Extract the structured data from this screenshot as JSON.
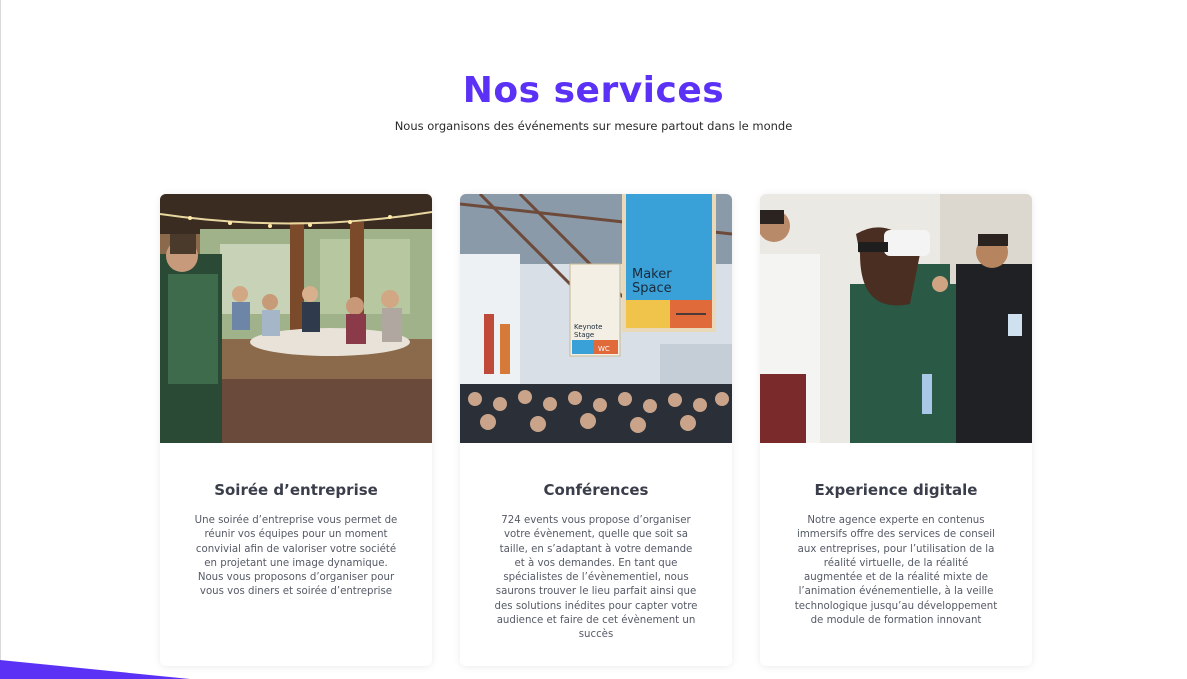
{
  "colors": {
    "accent": "#5b32f5",
    "title_text": "#3a3d4a",
    "body_text": "#555a66"
  },
  "header": {
    "title": "Nos services",
    "subtitle": "Nous organisons des événements sur mesure partout dans le monde"
  },
  "services": [
    {
      "title": "Soirée d’entreprise",
      "text": "Une soirée d’entreprise vous permet de réunir vos équipes pour un moment convivial afin de valoriser votre société en projetant une image dynamique. Nous vous proposons d’organiser pour vous vos diners et soirée d’entreprise",
      "image": "restaurant-party-photo"
    },
    {
      "title": "Conférences",
      "text": "724 events vous propose d’organiser votre évènement, quelle que soit sa taille, en s’adaptant à votre demande et à vos demandes. En tant que spécialistes de l’évènementiel, nous saurons trouver le lieu parfait ainsi que des solutions inédites pour capter votre audience et faire de cet évènement un succès",
      "image": "conference-hall-photo",
      "signs": {
        "maker": "Maker Space",
        "keynote": "Keynote Stage",
        "wc": "WC"
      }
    },
    {
      "title": "Experience digitale",
      "text": "Notre agence experte en contenus immersifs offre des services de conseil aux entreprises, pour l’utilisation de la réalité virtuelle, de la réalité augmentée et de la réalité mixte de l’animation événementielle, à la veille technologique jusqu’au développement de module de formation innovant",
      "image": "vr-headset-photo"
    }
  ]
}
